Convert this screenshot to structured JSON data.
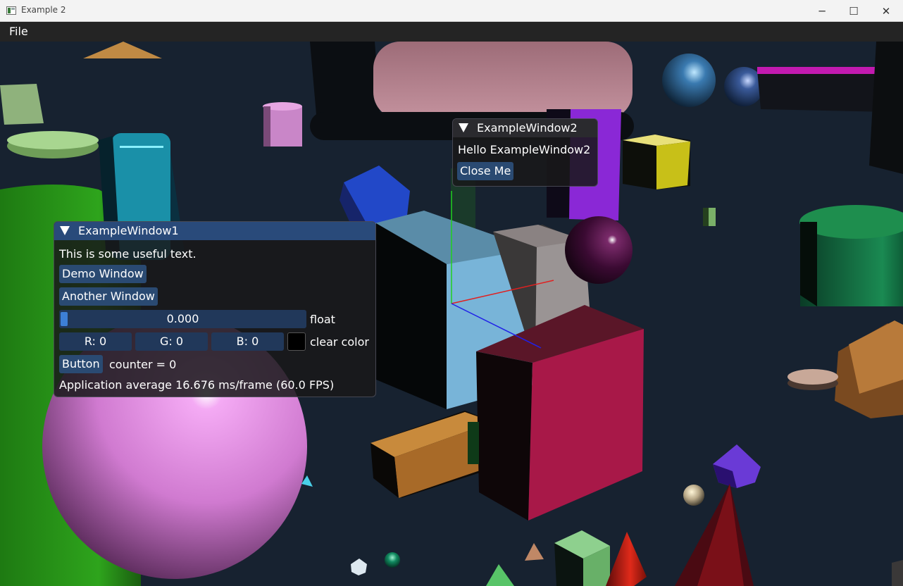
{
  "window": {
    "title": "Example 2",
    "minimize_glyph": "─",
    "maximize_glyph": "☐",
    "close_glyph": "✕"
  },
  "menubar": {
    "file_label": "File"
  },
  "example_window1": {
    "title": "ExampleWindow1",
    "text": "This is some useful text.",
    "demo_window_label": "Demo Window",
    "another_window_label": "Another Window",
    "slider": {
      "value_text": "0.000",
      "label": "float",
      "fraction": 0.0
    },
    "color": {
      "r_text": "R:  0",
      "g_text": "G:  0",
      "b_text": "B:  0",
      "label": "clear color",
      "swatch": "#000000"
    },
    "button_label": "Button",
    "counter_text": "counter = 0",
    "fps_text": "Application average 16.676 ms/frame (60.0 FPS)"
  },
  "example_window2": {
    "title": "ExampleWindow2",
    "text": "Hello ExampleWindow2",
    "close_label": "Close Me"
  },
  "colors": {
    "title_active": "#294a7a",
    "title_inactive": "#2a2a2e",
    "button": "#2a4a72",
    "frame": "#21385a",
    "grab": "#3d7fd6",
    "background": "#172230"
  }
}
